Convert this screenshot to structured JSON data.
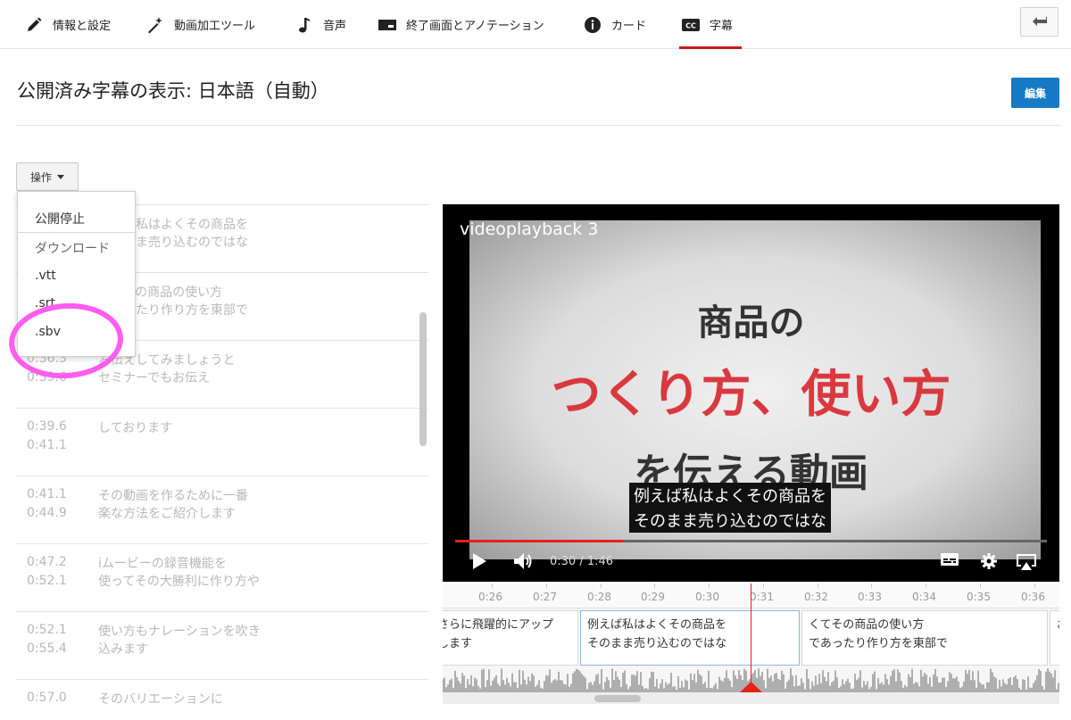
{
  "tabs": [
    {
      "label": "情報と設定",
      "icon": "pencil-icon"
    },
    {
      "label": "動画加工ツール",
      "icon": "magic-wand-icon"
    },
    {
      "label": "音声",
      "icon": "music-note-icon"
    },
    {
      "label": "終了画面とアノテーション",
      "icon": "end-screen-icon"
    },
    {
      "label": "カード",
      "icon": "info-icon"
    },
    {
      "label": "字幕",
      "icon": "cc-icon",
      "active": true
    }
  ],
  "header": {
    "title": "公開済み字幕の表示: 日本語（自動）",
    "edit_label": "編集",
    "back_icon": "back-arrow-icon"
  },
  "actions": {
    "label": "操作",
    "menu": {
      "unpublish": "公開停止",
      "download_header": "ダウンロード",
      "formats": [
        ".vtt",
        ".srt",
        ".sbv"
      ]
    }
  },
  "captions": [
    {
      "start": "",
      "end": "",
      "text_line1": "例えば私はよくその商品を",
      "text_line2": "そのまま売り込むのではな"
    },
    {
      "start": "",
      "end": "",
      "text_line1": "くてその商品の使い方",
      "text_line2": "であったり作り方を東部で"
    },
    {
      "start": "0:36.3",
      "end": "0:39.6",
      "text_line1": "お伝えしてみましょうと",
      "text_line2": "セミナーでもお伝え"
    },
    {
      "start": "0:39.6",
      "end": "0:41.1",
      "text_line1": "しております",
      "text_line2": ""
    },
    {
      "start": "0:41.1",
      "end": "0:44.9",
      "text_line1": "その動画を作るために一番",
      "text_line2": "楽な方法をご紹介します"
    },
    {
      "start": "0:47.2",
      "end": "0:52.1",
      "text_line1": "iムービーの録音機能を",
      "text_line2": "使ってその大勝利に作り方や"
    },
    {
      "start": "0:52.1",
      "end": "0:55.4",
      "text_line1": "使い方もナレーションを吹き",
      "text_line2": "込みます"
    },
    {
      "start": "0:57.0",
      "end": "",
      "text_line1": "そのバリエーションに",
      "text_line2": ""
    }
  ],
  "player": {
    "video_title": "videoplayback 3",
    "slide_line1": "商品の",
    "slide_line2": "つくり方、使い方",
    "slide_line3": "を伝える動画",
    "subtitle_line1": "例えば私はよくその商品を",
    "subtitle_line2": "そのまま売り込むのではな",
    "time_display": "0:30 / 1:46",
    "progress_fraction": 0.283,
    "accent_color": "#e62117"
  },
  "timeline": {
    "ticks": [
      "0:26",
      "0:27",
      "0:28",
      "0:29",
      "0:30",
      "0:31",
      "0:32",
      "0:33",
      "0:34",
      "0:35",
      "0:36"
    ],
    "segments": [
      {
        "line1": "さらに飛躍的にアップ",
        "line2": "します"
      },
      {
        "line1": "例えば私はよくその商品を",
        "line2": "そのまま売り込むのではな"
      },
      {
        "line1": "くてその商品の使い方",
        "line2": "であったり作り方を東部で"
      },
      {
        "line1": "お",
        "line2": ""
      }
    ]
  }
}
